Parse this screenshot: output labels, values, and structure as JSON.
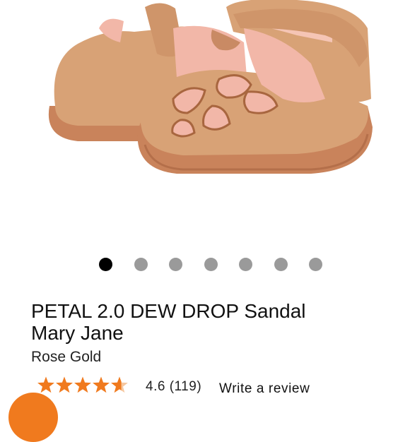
{
  "product": {
    "title_line1": "PETAL 2.0 DEW DROP Sandal",
    "title_line2": "Mary Jane",
    "color_name": "Rose Gold",
    "rating_value": "4.6",
    "review_count": "(119)",
    "rating_fraction": 0.92,
    "write_review_label": "Write a review"
  },
  "gallery": {
    "image_count": 7,
    "active_index": 0,
    "image_alt": "product-photo-rose-gold-sandals"
  },
  "colors": {
    "star": "#f07a1e",
    "fab": "#f07a1e",
    "dot_active": "#000000",
    "dot_inactive": "#9a9a9a",
    "shoe_gold": "#d8a276",
    "shoe_sole": "#c9835b",
    "shoe_lining": "#f2b7a8"
  },
  "icons": {
    "fab": "chat-bubble-icon",
    "stars": "star-rating-icon"
  }
}
